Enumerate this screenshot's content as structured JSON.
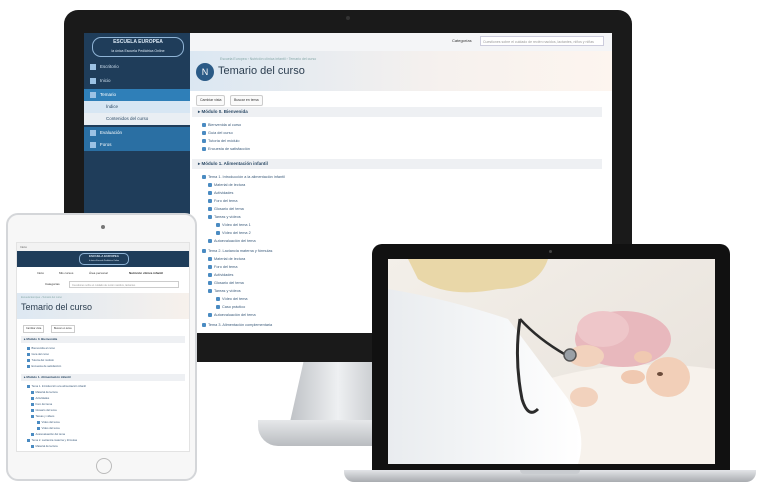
{
  "brand": {
    "logo_text": "ESCUELA EUROPEA",
    "logo_sub": "la única Escuela Pediátrica Online"
  },
  "monitor": {
    "sidebar": {
      "items": [
        {
          "label": "Escritorio"
        },
        {
          "label": "Inicio"
        },
        {
          "label": "Temario"
        },
        {
          "label": "Índice"
        },
        {
          "label": "Contenidos del curso"
        },
        {
          "label": "Evaluación"
        },
        {
          "label": "Foros"
        }
      ]
    },
    "topbar": {
      "category_label": "Categorías",
      "category_value": "Cuestiones sobre el cuidado de recién nacidos, lactantes, niños y niñas"
    },
    "header": {
      "breadcrumb": "Escuela Europea › Nutrición clínica infantil › Temario del curso",
      "title": "Temario del curso",
      "badge": "N"
    },
    "buttons": [
      {
        "label": "Cambiar vista"
      },
      {
        "label": "Buscar en tema"
      }
    ],
    "sections": [
      {
        "title": "Módulo 0. Bienvenida",
        "items": [
          "Bienvenida al curso",
          "Guía del curso",
          "Tutoría del módulo",
          "Encuesta de satisfacción"
        ]
      },
      {
        "title": "Módulo 1. Alimentación infantil",
        "items": [
          "Tema 1. Introducción a la alimentación infantil",
          "Material de lectura",
          "Actividades",
          "Foro del tema",
          "Glosario del tema",
          "Tareas y vídeos",
          "Vídeo del tema 1",
          "Vídeo del tema 2",
          "Autoevaluación del tema",
          "Tema 2. Lactancia materna y fórmulas",
          "Material de lectura",
          "Foro del tema",
          "Actividades",
          "Glosario del tema",
          "Tareas y vídeos",
          "Vídeo del tema",
          "Caso práctico",
          "Autoevaluación del tema",
          "Tema 3. Alimentación complementaria"
        ]
      }
    ]
  },
  "tablet": {
    "statusbar": "Inicio",
    "nav": [
      {
        "label": "Inicio"
      },
      {
        "label": "Mis cursos"
      },
      {
        "label": "Área personal"
      },
      {
        "label": "Nutrición clínica infantil"
      }
    ],
    "category_label": "Categorías",
    "category_value": "Cuestiones sobre el cuidado de recién nacidos, lactantes",
    "breadcrumb": "Escuela Europea › Temario del curso",
    "title": "Temario del curso",
    "buttons": [
      {
        "label": "Cambiar vista"
      },
      {
        "label": "Buscar en tema"
      }
    ],
    "sections": [
      {
        "title": "Módulo 0. Bienvenida",
        "items": [
          "Bienvenida al curso",
          "Guía del curso",
          "Tutoría del módulo",
          "Encuesta de satisfacción"
        ]
      },
      {
        "title": "Módulo 1. Alimentación infantil",
        "items": [
          "Tema 1. Introducción a la alimentación infantil",
          "Material de lectura",
          "Actividades",
          "Foro del tema",
          "Glosario del tema",
          "Tareas y vídeos",
          "Vídeo del tema",
          "Vídeo del tema",
          "Autoevaluación del tema",
          "Tema 2. Lactancia materna y fórmulas",
          "Material de lectura",
          "Actividades"
        ]
      }
    ]
  },
  "laptop": {
    "image": "pediatrician-examining-baby-photo"
  },
  "colors": {
    "sidebar": "#1f3d5a",
    "accent": "#2f7fb8",
    "title": "#2c3e50"
  }
}
